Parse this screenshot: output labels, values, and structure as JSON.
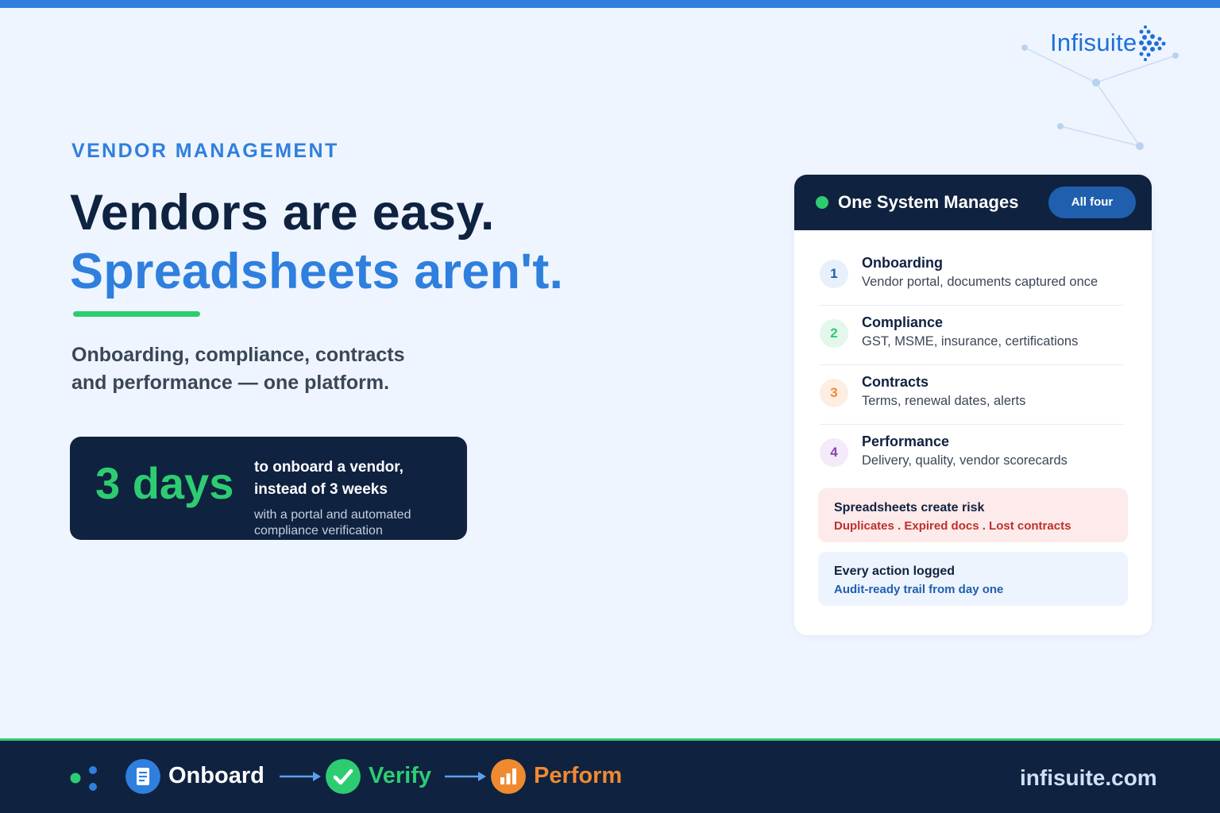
{
  "brand": {
    "logo_text": "Infisuite",
    "logo_icon": "dot-cluster-icon",
    "colors": {
      "primary": "#2f7fde",
      "navy": "#0f2240",
      "green": "#2ecc71",
      "orange": "#f08a30",
      "purple": "#8e44ad",
      "risk": "#c0302b"
    }
  },
  "hero": {
    "eyebrow": "VENDOR MANAGEMENT",
    "headline_line1": "Vendors are easy.",
    "headline_line2": "Spreadsheets aren't.",
    "subheadline_line1": "Onboarding, compliance, contracts",
    "subheadline_line2": "and performance — one platform."
  },
  "stat": {
    "value": "3 days",
    "main_line1": "to onboard a vendor,",
    "main_line2": "instead of 3 weeks",
    "note_line1": "with a portal and automated",
    "note_line2": "compliance verification"
  },
  "panel": {
    "title": "One System Manages",
    "badge": "All four",
    "items": [
      {
        "num": "1",
        "title": "Onboarding",
        "desc": "Vendor portal, documents captured once",
        "color": "#1f5fae",
        "bg": "#e8f0fb"
      },
      {
        "num": "2",
        "title": "Compliance",
        "desc": "GST, MSME, insurance, certifications",
        "color": "#2ecc71",
        "bg": "#e3f7ec"
      },
      {
        "num": "3",
        "title": "Contracts",
        "desc": "Terms, renewal dates, alerts",
        "color": "#f08a30",
        "bg": "#fdeee2"
      },
      {
        "num": "4",
        "title": "Performance",
        "desc": "Delivery, quality, vendor scorecards",
        "color": "#8e44ad",
        "bg": "#f3eafa"
      }
    ],
    "risk_note": {
      "title": "Spreadsheets create risk",
      "sub": "Duplicates . Expired docs . Lost contracts"
    },
    "log_note": {
      "title": "Every action logged",
      "sub": "Audit-ready trail from day one"
    }
  },
  "footer": {
    "steps": [
      {
        "label": "Onboard",
        "icon": "document-icon",
        "color": "#ffffff",
        "icon_bg": "#2f7fde"
      },
      {
        "label": "Verify",
        "icon": "checkmark-icon",
        "color": "#2ecc71",
        "icon_bg": "#2ecc71"
      },
      {
        "label": "Perform",
        "icon": "bar-chart-icon",
        "color": "#f08a30",
        "icon_bg": "#f08a30"
      }
    ],
    "website": "infisuite.com"
  }
}
